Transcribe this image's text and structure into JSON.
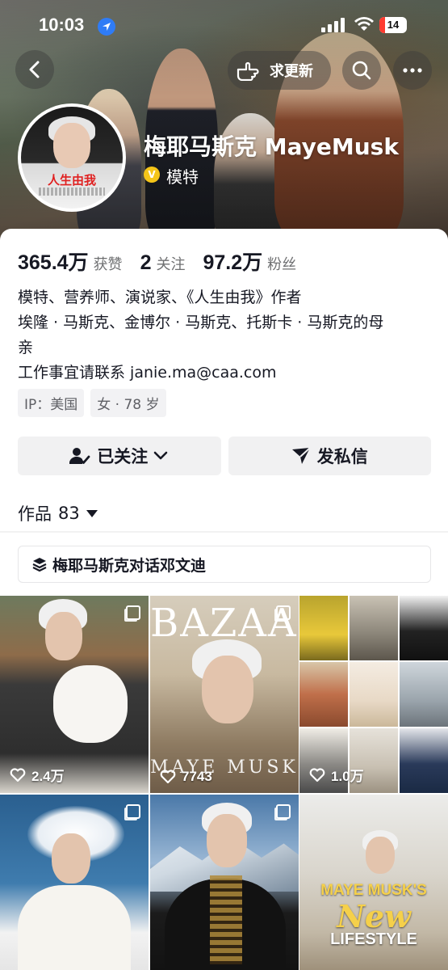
{
  "status_bar": {
    "time": "10:03",
    "battery": "14"
  },
  "nav": {
    "update_label": "求更新"
  },
  "profile": {
    "name": "梅耶马斯克 MayeMusk",
    "verify_label": "模特",
    "avatar_book_title": "人生由我"
  },
  "stats": [
    {
      "value": "365.4万",
      "label": "获赞"
    },
    {
      "value": "2",
      "label": "关注"
    },
    {
      "value": "97.2万",
      "label": "粉丝"
    }
  ],
  "bio": {
    "line1": "模特、营养师、演说家、《人生由我》作者",
    "line2": "埃隆 · 马斯克、金博尔 · 马斯克、托斯卡 · 马斯克的母",
    "line3": "亲",
    "line4": "工作事宜请联系 janie.ma@caa.com"
  },
  "tags": {
    "ip": "IP：美国",
    "gender_age": "女 · 78 岁"
  },
  "actions": {
    "following": "已关注",
    "message": "发私信"
  },
  "works": {
    "label": "作品",
    "count": "83"
  },
  "collection": {
    "title": "梅耶马斯克对话邓文迪"
  },
  "posts": [
    {
      "likes": "2.4万",
      "multi": true
    },
    {
      "likes": "7743",
      "multi": true,
      "cover_text": "BAZAAR",
      "cover_sub": "MAYE MUSK"
    },
    {
      "likes": "1.0万",
      "multi": false
    },
    {
      "likes": "",
      "multi": true
    },
    {
      "likes": "",
      "multi": true
    },
    {
      "likes": "",
      "multi": false,
      "title": "MAYE MUSK'S",
      "title_big": "New",
      "title_sub": "LIFESTYLE"
    }
  ],
  "colors": {
    "accent_verified": "#f5c518",
    "location_blue": "#2f7cf6",
    "battery_red": "#ff3b30",
    "button_bg": "#f1f1f2"
  }
}
